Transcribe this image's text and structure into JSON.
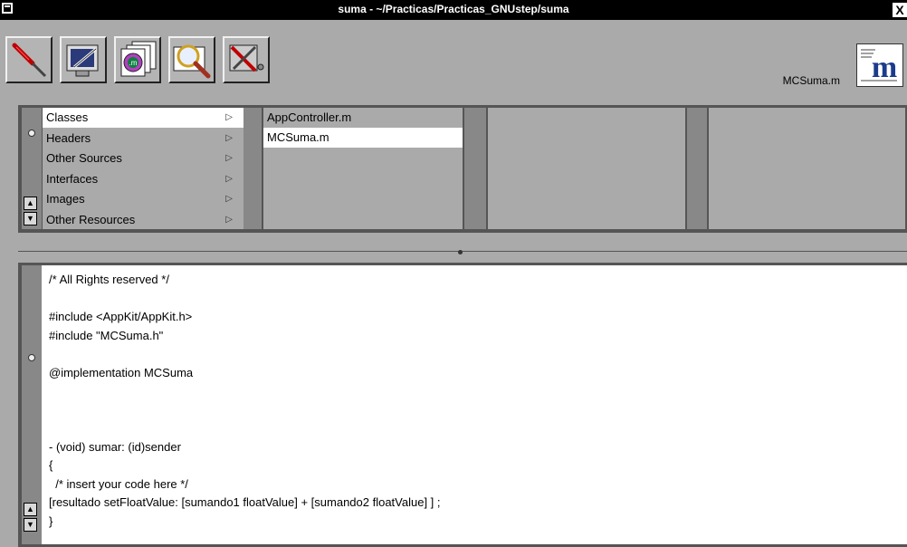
{
  "window": {
    "title": "suma - ~/Practicas/Practicas_GNUstep/suma",
    "close_glyph": "X"
  },
  "toolbar": {
    "buttons": [
      {
        "name": "build-tool",
        "icon": "screwdriver-icon"
      },
      {
        "name": "inspector-tool",
        "icon": "monitor-pen-icon"
      },
      {
        "name": "files-tool",
        "icon": "file-m-icon"
      },
      {
        "name": "find-tool",
        "icon": "magnifier-icon"
      },
      {
        "name": "launch-tool",
        "icon": "tools-icon"
      }
    ],
    "current_file": "MCSuma.m",
    "file_icon": "objc-m-file-icon"
  },
  "browser": {
    "categories": [
      {
        "label": "Classes",
        "selected": true
      },
      {
        "label": "Headers"
      },
      {
        "label": "Other Sources"
      },
      {
        "label": "Interfaces"
      },
      {
        "label": "Images"
      },
      {
        "label": "Other Resources"
      }
    ],
    "files": [
      {
        "label": "AppController.m"
      },
      {
        "label": "MCSuma.m",
        "selected": true
      }
    ]
  },
  "editor": {
    "lines": [
      "/* All Rights reserved */",
      "",
      "#include <AppKit/AppKit.h>",
      "#include \"MCSuma.h\"",
      "",
      "@implementation MCSuma",
      "",
      "",
      "",
      "- (void) sumar: (id)sender",
      "{",
      "  /* insert your code here */",
      "[resultado setFloatValue: [sumando1 floatValue] + [sumando2 floatValue] ] ;",
      "}"
    ]
  },
  "colors": {
    "window_bg": "#aaaaaa",
    "titlebar_bg": "#000000",
    "selection_bg": "#ffffff"
  }
}
